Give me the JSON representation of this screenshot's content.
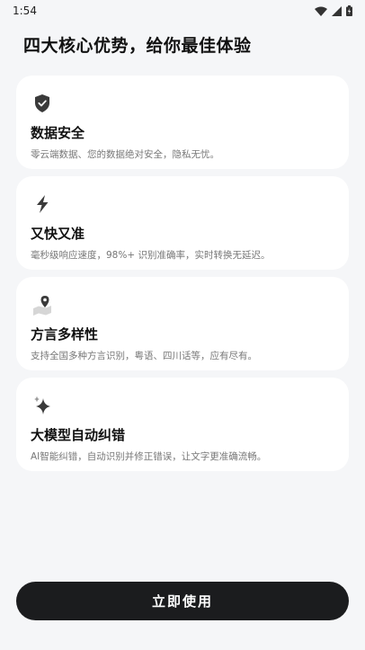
{
  "status_bar": {
    "time": "1:54"
  },
  "page": {
    "title": "四大核心优势，给你最佳体验"
  },
  "features": [
    {
      "title": "数据安全",
      "description": "零云端数据、您的数据绝对安全，隐私无忧。",
      "icon": "shield-icon"
    },
    {
      "title": "又快又准",
      "description": "毫秒级响应速度，98%+ 识别准确率，实时转换无延迟。",
      "icon": "lightning-icon"
    },
    {
      "title": "方言多样性",
      "description": "支持全国多种方言识别，粤语、四川话等，应有尽有。",
      "icon": "map-pin-icon"
    },
    {
      "title": "大模型自动纠错",
      "description": "AI智能纠错，自动识别并修正错误，让文字更准确流畅。",
      "icon": "sparkle-icon"
    }
  ],
  "cta": {
    "label": "立即使用"
  }
}
